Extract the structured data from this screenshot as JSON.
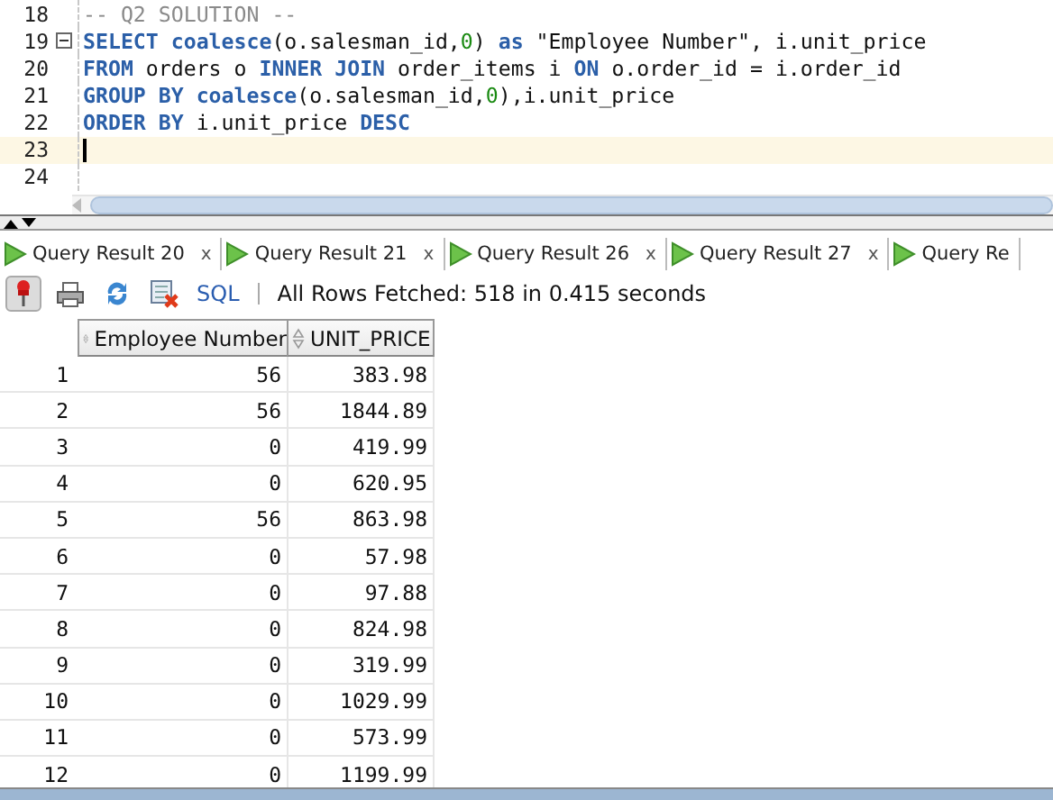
{
  "editor": {
    "lines": [
      {
        "number": "18",
        "fold": false,
        "current": false,
        "tokens": [
          {
            "kind": "comment",
            "text": "-- Q2 SOLUTION --"
          }
        ]
      },
      {
        "number": "19",
        "fold": true,
        "current": false,
        "tokens": [
          {
            "kind": "keyword",
            "text": "SELECT coalesce"
          },
          {
            "kind": "plain",
            "text": "(o.salesman_id,"
          },
          {
            "kind": "number",
            "text": "0"
          },
          {
            "kind": "plain",
            "text": ") "
          },
          {
            "kind": "keyword",
            "text": "as"
          },
          {
            "kind": "plain",
            "text": " \"Employee Number\", i.unit_price"
          }
        ]
      },
      {
        "number": "20",
        "fold": false,
        "current": false,
        "tokens": [
          {
            "kind": "keyword",
            "text": "FROM"
          },
          {
            "kind": "plain",
            "text": " orders o "
          },
          {
            "kind": "keyword",
            "text": "INNER JOIN"
          },
          {
            "kind": "plain",
            "text": " order_items i "
          },
          {
            "kind": "keyword",
            "text": "ON"
          },
          {
            "kind": "plain",
            "text": " o.order_id = i.order_id"
          }
        ]
      },
      {
        "number": "21",
        "fold": false,
        "current": false,
        "tokens": [
          {
            "kind": "keyword",
            "text": "GROUP BY coalesce"
          },
          {
            "kind": "plain",
            "text": "(o.salesman_id,"
          },
          {
            "kind": "number",
            "text": "0"
          },
          {
            "kind": "plain",
            "text": "),i.unit_price"
          }
        ]
      },
      {
        "number": "22",
        "fold": false,
        "current": false,
        "tokens": [
          {
            "kind": "keyword",
            "text": "ORDER BY"
          },
          {
            "kind": "plain",
            "text": " i.unit_price "
          },
          {
            "kind": "keyword",
            "text": "DESC"
          }
        ]
      },
      {
        "number": "23",
        "fold": false,
        "current": true
      },
      {
        "number": "24",
        "fold": false,
        "current": false
      }
    ]
  },
  "result_tabs": [
    {
      "label": "Query Result 20",
      "close": "x"
    },
    {
      "label": "Query Result 21",
      "close": "x"
    },
    {
      "label": "Query Result 26",
      "close": "x"
    },
    {
      "label": "Query Result 27",
      "close": "x"
    },
    {
      "label": "Query Re"
    }
  ],
  "toolbar": {
    "pin_pressed": true,
    "sql_link": "SQL",
    "status": "All Rows Fetched: 518 in 0.415 seconds"
  },
  "table": {
    "columns": [
      "",
      "Employee Number",
      "UNIT_PRICE"
    ],
    "rows": [
      [
        "1",
        "56",
        "383.98"
      ],
      [
        "2",
        "56",
        "1844.89"
      ],
      [
        "3",
        "0",
        "419.99"
      ],
      [
        "4",
        "0",
        "620.95"
      ],
      [
        "5",
        "56",
        "863.98"
      ],
      [
        "6",
        "0",
        "57.98"
      ],
      [
        "7",
        "0",
        "97.88"
      ],
      [
        "8",
        "0",
        "824.98"
      ],
      [
        "9",
        "0",
        "319.99"
      ],
      [
        "10",
        "0",
        "1029.99"
      ],
      [
        "11",
        "0",
        "573.99"
      ],
      [
        "12",
        "0",
        "1199.99"
      ]
    ]
  }
}
